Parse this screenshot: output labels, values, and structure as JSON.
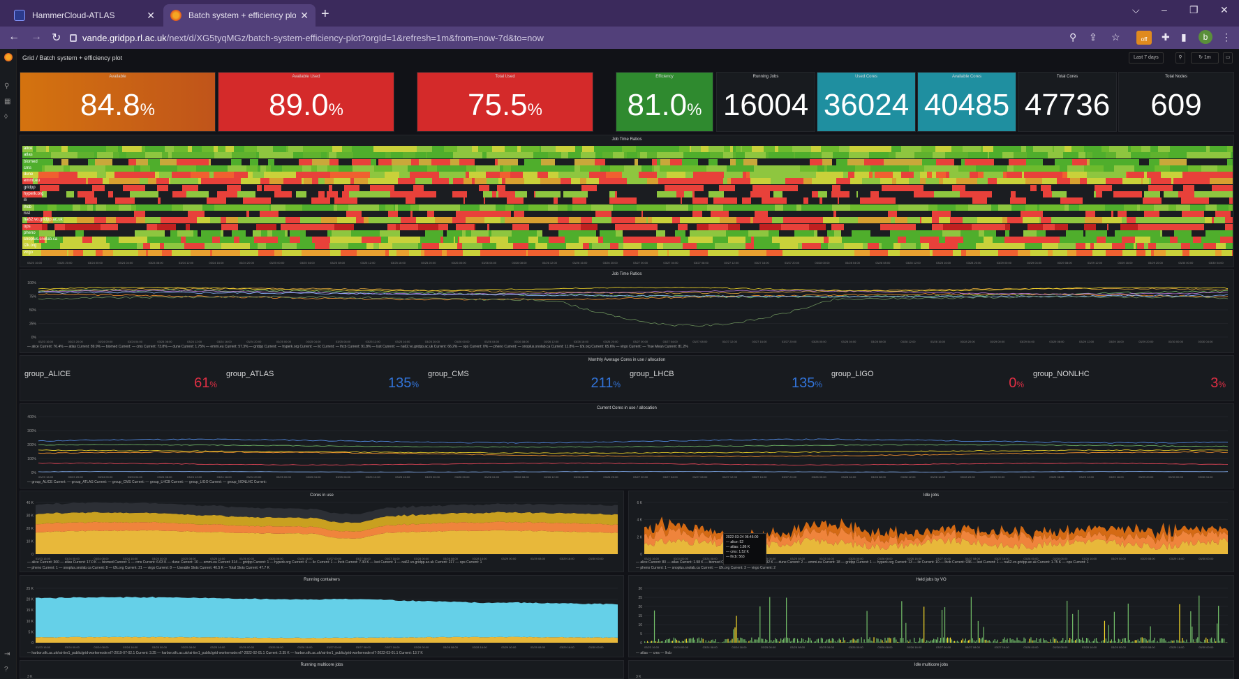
{
  "browser": {
    "tabs": [
      {
        "title": "HammerCloud-ATLAS",
        "close": "✕"
      },
      {
        "title": "Batch system + efficiency plot - G",
        "close": "✕"
      }
    ],
    "new_tab": "+",
    "window_controls": {
      "dropdown": "⌵",
      "minimize": "–",
      "restore": "❐",
      "close": "✕"
    },
    "url_host": "vande.gridpp.rl.ac.uk",
    "url_path": "/next/d/XG5tyqMGz/batch-system-efficiency-plot?orgId=1&refresh=1m&from=now-7d&to=now",
    "extension_badge": "off",
    "profile_initial": "b"
  },
  "grafana": {
    "breadcrumb": "Grid / Batch system + efficiency plot",
    "time_range": "Last 7 days",
    "refresh": "1m"
  },
  "stats": [
    {
      "title": "Available",
      "value": "84.8",
      "unit": "%",
      "color": "#d46a14"
    },
    {
      "title": "Available Used",
      "value": "89.0",
      "unit": "%",
      "color": "#d42a2a"
    },
    {
      "title": "Total Used",
      "value": "75.5",
      "unit": "%",
      "color": "#d42a2a"
    },
    {
      "title": "Efficiency",
      "value": "81.0",
      "unit": "%",
      "color": "#2f8a2f"
    },
    {
      "title": "Running Jobs",
      "value": "16004",
      "unit": "",
      "color": ""
    },
    {
      "title": "Used Cores",
      "value": "36024",
      "unit": "",
      "color": "#1f8fa0"
    },
    {
      "title": "Available Cores",
      "value": "40485",
      "unit": "",
      "color": "#1f8fa0"
    },
    {
      "title": "Total Cores",
      "value": "47736",
      "unit": "",
      "color": ""
    },
    {
      "title": "Total Nodes",
      "value": "609",
      "unit": "",
      "color": ""
    }
  ],
  "heatmap": {
    "title": "Job Time Ratios",
    "rows": [
      "alice",
      "atlas",
      "biomed",
      "cms",
      "dune",
      "emmi.eu",
      "gridpp",
      "hyperk.org",
      "ili",
      "lhcb",
      "lsst",
      "na62.vo.gridpp.ac.uk",
      "ops",
      "pheno",
      "snoplus.snolab.ca",
      "t2k.org",
      "virgo"
    ]
  },
  "line_ratio": {
    "title": "Job Time Ratios",
    "legend": "— alice Current: 76.4%  — atlas Current: 89.9%  — biomed Current:  — cms Current: 73.8%  — dune Current: 1.75%  — emmi.eu Current: 57.3%  — gridpp Current:  — hyperk.org Current:  — ilc Current:  — lhcb Current: 91.8%  — lsst Current:  — na62.vo.gridpp.ac.uk Current: 66.2%  — ops Current: 0%  — pheno Current:  — snoplus.snolab.ca Current: 11.8%  — t2k.org Current: 65.6%  — virgo Current:  — True Mean Current: 81.2%"
  },
  "gauges": {
    "title": "Monthly Average Cores in use / allocation",
    "items": [
      {
        "name": "group_ALICE",
        "value": "61",
        "unit": "%",
        "color": "#e02f44"
      },
      {
        "name": "group_ATLAS",
        "value": "135",
        "unit": "%",
        "color": "#3274d9"
      },
      {
        "name": "group_CMS",
        "value": "211",
        "unit": "%",
        "color": "#3274d9"
      },
      {
        "name": "group_LHCB",
        "value": "135",
        "unit": "%",
        "color": "#3274d9"
      },
      {
        "name": "group_LIGO",
        "value": "0",
        "unit": "%",
        "color": "#e02f44"
      },
      {
        "name": "group_NONLHC",
        "value": "3",
        "unit": "%",
        "color": "#e02f44"
      }
    ]
  },
  "line_alloc": {
    "title": "Current Cores in use / allocation",
    "legend": "— group_ALICE Current:  — group_ATLAS Current:  — group_CMS Current:  — group_LHCB Current:  — group_LIGO Current:  — group_NONLHC Current:"
  },
  "cores_in_use": {
    "title": "Cores in use",
    "yticks": [
      "40 K",
      "30 K",
      "20 K",
      "10 K",
      "0"
    ],
    "legend1": "— alice Current: 360  — atlas Current: 17.0 K  — biomed Current: 1  — cms Current: 6.03 K  — dune Current: 10  — emmi.eu Current: 314  — gridpp Current: 1  — hyperk.org Current: 0  — ilc Current: 1  — lhcb Current: 7.30 K  — lsst Current: 1  — na62.vo.gridpp.ac.uk Current: 217  — ops Current: 1",
    "legend2": "— pheno Current: 1  — snoplus.snolab.ca Current: 8  — t2k.org Current: 21  — virgo Current: 8  — Useable Slots Current: 40.5 K  — Total Slots Current: 47.7 K"
  },
  "idle_jobs": {
    "title": "Idle jobs",
    "yticks": [
      "6 K",
      "4 K",
      "2 K",
      "0"
    ],
    "legend1": "— alice Current: 80  — atlas Current: 1.98 K  — biomed Current: 1  — cms Current: 1.32 K  — dune Current: 2  — emmi.eu Current: 18  — gridpp Current: 1  — hyperk.org Current: 13  — ilc Current: 10  — lhcb Current: 936  — lsst Current: 1  — na62.vo.gridpp.ac.uk Current: 1.75 K  — ops Current: 1",
    "legend2": "— pheno Current: 1  — snoplus.snolab.ca Current:  — t2k.org Current: 3  — virgo Current: 2",
    "tooltip": {
      "time": "2022-03-24 06:46:00",
      "rows": [
        "— alice:  52",
        "— atlas:  1.86 K",
        "— cms:  1.52 K",
        "— lhcb:  563"
      ]
    }
  },
  "running_containers": {
    "title": "Running containers",
    "yticks": [
      "25 K",
      "20 K",
      "15 K",
      "10 K",
      "5 K",
      "0"
    ],
    "legend": "— harbor.stfc.ac.uk/rai-tier1_public/grid-workernode:el7-2019-07-02.1 Current: 3.25  — harbor.stfc.ac.uk/rai-tier1_public/grid-workernode:el7-2022-02-01.1 Current: 2.35 K  — harbor.stfc.ac.uk/rai-tier1_public/grid-workernode:el7-2022-03-01.1 Current: 13.7 K"
  },
  "held_jobs": {
    "title": "Held jobs by VO",
    "yticks": [
      "30",
      "25",
      "20",
      "15",
      "10",
      "5",
      "0"
    ],
    "legend": "— atlas  — cms  — lhcb"
  },
  "bottom_panels": [
    {
      "title": "Running multicore jobs",
      "ytick": "3 K"
    },
    {
      "title": "Idle multicore jobs",
      "ytick": "3 K"
    }
  ],
  "time_axis": [
    "03/23 16:00",
    "03/23 20:00",
    "03/24 00:00",
    "03/24 04:00",
    "03/24 08:00",
    "03/24 12:00",
    "03/24 16:00",
    "03/24 20:00",
    "03/25 00:00",
    "03/25 04:00",
    "03/25 08:00",
    "03/25 12:00",
    "03/25 16:00",
    "03/25 20:00",
    "03/26 00:00",
    "03/26 04:00",
    "03/26 08:00",
    "03/26 12:00",
    "03/26 16:00",
    "03/26 20:00",
    "03/27 00:00",
    "03/27 04:00",
    "03/27 08:00",
    "03/27 12:00",
    "03/27 16:00",
    "03/27 20:00",
    "03/28 00:00",
    "03/28 04:00",
    "03/28 08:00",
    "03/28 12:00",
    "03/28 16:00",
    "03/28 20:00",
    "03/29 00:00",
    "03/29 04:00",
    "03/29 08:00",
    "03/29 12:00",
    "03/29 16:00",
    "03/29 20:00",
    "03/30 00:00",
    "03/30 04:00"
  ],
  "ratio_yticks": [
    "100%",
    "75%",
    "50%",
    "25%",
    "0%"
  ],
  "alloc_yticks": [
    "400%",
    "300%",
    "200%",
    "100%",
    "0%"
  ]
}
